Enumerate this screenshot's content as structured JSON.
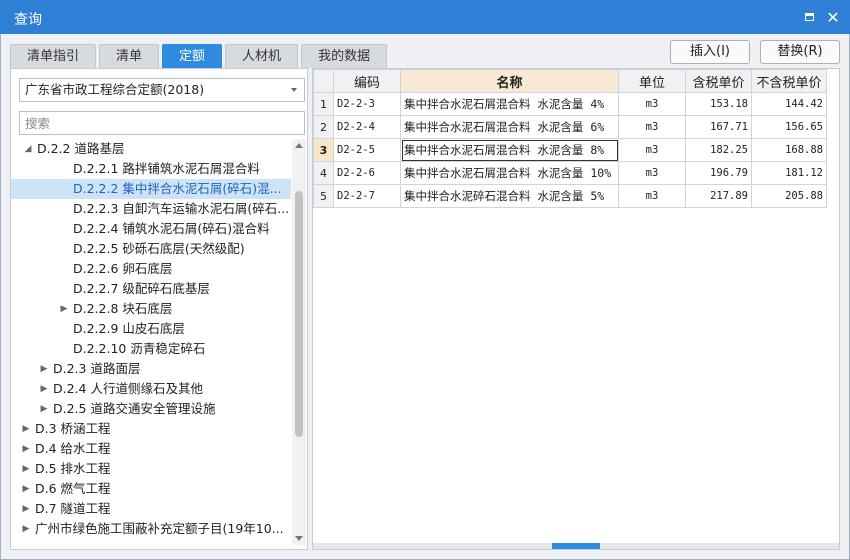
{
  "window": {
    "title": "查询"
  },
  "tabs": [
    {
      "label": "清单指引",
      "active": false
    },
    {
      "label": "清单",
      "active": false
    },
    {
      "label": "定额",
      "active": true
    },
    {
      "label": "人材机",
      "active": false
    },
    {
      "label": "我的数据",
      "active": false
    }
  ],
  "buttons": {
    "insert": "插入(I)",
    "replace": "替换(R)"
  },
  "library_select": {
    "value": "广东省市政工程综合定额(2018)"
  },
  "search": {
    "placeholder": "搜索",
    "value": ""
  },
  "tree": [
    {
      "label": "D.2.2 道路基层",
      "toggle": "open",
      "selected": false
    },
    {
      "label": "D.2.2.1 路拌铺筑水泥石屑混合料",
      "toggle": "",
      "selected": false
    },
    {
      "label": "D.2.2.2 集中拌合水泥石屑(碎石)混...",
      "toggle": "",
      "selected": true
    },
    {
      "label": "D.2.2.3 自卸汽车运输水泥石屑(碎石...",
      "toggle": "",
      "selected": false
    },
    {
      "label": "D.2.2.4 铺筑水泥石屑(碎石)混合料",
      "toggle": "",
      "selected": false
    },
    {
      "label": "D.2.2.5 砂砾石底层(天然级配)",
      "toggle": "",
      "selected": false
    },
    {
      "label": "D.2.2.6 卵石底层",
      "toggle": "",
      "selected": false
    },
    {
      "label": "D.2.2.7 级配碎石底基层",
      "toggle": "",
      "selected": false
    },
    {
      "label": "D.2.2.8 块石底层",
      "toggle": "closed",
      "selected": false
    },
    {
      "label": "D.2.2.9 山皮石底层",
      "toggle": "",
      "selected": false
    },
    {
      "label": "D.2.2.10 沥青稳定碎石",
      "toggle": "",
      "selected": false
    },
    {
      "label": "D.2.3 道路面层",
      "toggle": "closed",
      "selected": false
    },
    {
      "label": "D.2.4 人行道侧缘石及其他",
      "toggle": "closed",
      "selected": false
    },
    {
      "label": "D.2.5 道路交通安全管理设施",
      "toggle": "closed",
      "selected": false
    },
    {
      "label": "D.3 桥涵工程",
      "toggle": "closed",
      "selected": false
    },
    {
      "label": "D.4 给水工程",
      "toggle": "closed",
      "selected": false
    },
    {
      "label": "D.5 排水工程",
      "toggle": "closed",
      "selected": false
    },
    {
      "label": "D.6 燃气工程",
      "toggle": "closed",
      "selected": false
    },
    {
      "label": "D.7 隧道工程",
      "toggle": "closed",
      "selected": false
    },
    {
      "label": "广州市绿色施工围蔽补充定额子目(19年10...",
      "toggle": "closed",
      "selected": false
    }
  ],
  "table": {
    "headers": {
      "code": "编码",
      "name": "名称",
      "unit": "单位",
      "price_tax": "含税单价",
      "price_notax": "不含税单价"
    },
    "rows": [
      {
        "no": "1",
        "code": "D2-2-3",
        "name": "集中拌合水泥石屑混合料 水泥含量 4%",
        "unit": "m3",
        "price_tax": "153.18",
        "price_notax": "144.42"
      },
      {
        "no": "2",
        "code": "D2-2-4",
        "name": "集中拌合水泥石屑混合料 水泥含量 6%",
        "unit": "m3",
        "price_tax": "167.71",
        "price_notax": "156.65"
      },
      {
        "no": "3",
        "code": "D2-2-5",
        "name": "集中拌合水泥石屑混合料 水泥含量 8%",
        "unit": "m3",
        "price_tax": "182.25",
        "price_notax": "168.88"
      },
      {
        "no": "4",
        "code": "D2-2-6",
        "name": "集中拌合水泥石屑混合料 水泥含量 10%",
        "unit": "m3",
        "price_tax": "196.79",
        "price_notax": "181.12"
      },
      {
        "no": "5",
        "code": "D2-2-7",
        "name": "集中拌合水泥碎石混合料 水泥含量 5%",
        "unit": "m3",
        "price_tax": "217.89",
        "price_notax": "205.88"
      }
    ]
  }
}
